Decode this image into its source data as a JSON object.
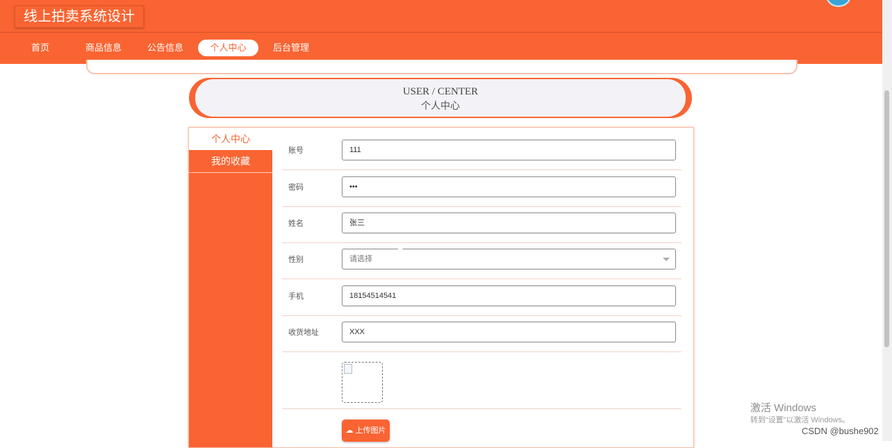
{
  "header": {
    "site_title": "线上拍卖系统设计"
  },
  "nav": {
    "items": [
      {
        "label": "首页"
      },
      {
        "label": "商品信息"
      },
      {
        "label": "公告信息"
      },
      {
        "label": "个人中心",
        "active": true
      },
      {
        "label": "后台管理"
      }
    ]
  },
  "banner": {
    "title_en": "USER / CENTER",
    "title_cn": "个人中心"
  },
  "sidebar": {
    "items": [
      {
        "label": "个人中心",
        "active": true
      },
      {
        "label": "我的收藏"
      }
    ]
  },
  "form": {
    "fields": [
      {
        "label": "账号",
        "value": "111"
      },
      {
        "label": "密码",
        "value": "•••"
      },
      {
        "label": "姓名",
        "value": "张三"
      },
      {
        "label": "性别",
        "placeholder": "请选择"
      },
      {
        "label": "手机",
        "value": "18154514541"
      },
      {
        "label": "收货地址",
        "value": "XXX"
      }
    ],
    "upload_label": "上传图片"
  },
  "overlay": {
    "activate_title": "激活 Windows",
    "activate_sub": "转到“设置”以激活 Windows。",
    "watermark": "CSDN @bushe902"
  },
  "colors": {
    "accent": "#f96432",
    "accent_light": "#f8c2b0"
  }
}
